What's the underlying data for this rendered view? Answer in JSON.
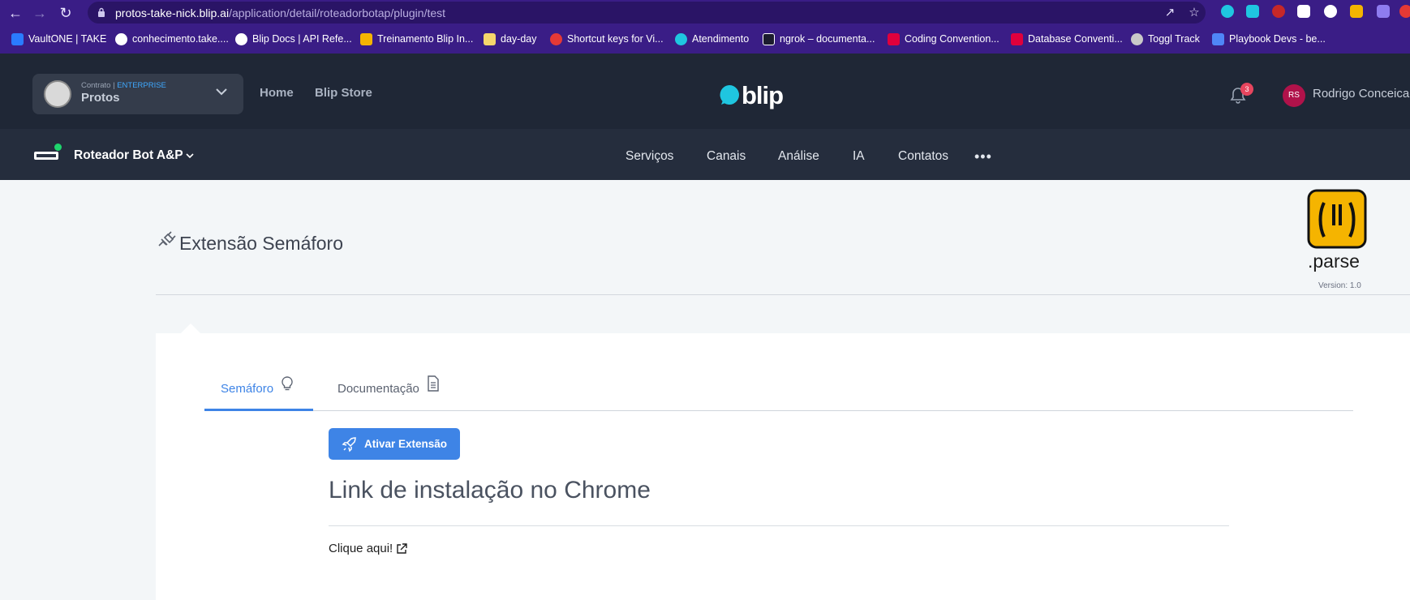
{
  "browser": {
    "url_host": "protos-take-nick.blip.ai",
    "url_path": "/application/detail/roteadorbotap/plugin/test",
    "bookmarks": [
      {
        "label": "VaultONE | TAKE",
        "color": "#2a7bff"
      },
      {
        "label": "conhecimento.take....",
        "color": "#ffffff"
      },
      {
        "label": "Blip Docs | API Refe...",
        "color": "#ffffff"
      },
      {
        "label": "Treinamento Blip In...",
        "color": "#f4b400"
      },
      {
        "label": "day-day",
        "color": "#f6d66b"
      },
      {
        "label": "Shortcut keys for Vi...",
        "color": "#e53935"
      },
      {
        "label": "Atendimento",
        "color": "#1fc6e0"
      },
      {
        "label": "ngrok – documenta...",
        "color": "#1c1c2e"
      },
      {
        "label": "Coding Convention...",
        "color": "#e0003c"
      },
      {
        "label": "Database Conventi...",
        "color": "#e0003c"
      },
      {
        "label": "Toggl Track",
        "color": "#c9c9c9"
      },
      {
        "label": "Playbook Devs - be...",
        "color": "#4f86f7"
      }
    ]
  },
  "header": {
    "contract_label": "Contrato |",
    "contract_tier": "ENTERPRISE",
    "contract_name": "Protos",
    "nav_home": "Home",
    "nav_store": "Blip Store",
    "logo_text": "blip",
    "notification_count": "3",
    "user_initials": "RS",
    "user_name": "Rodrigo Conceicao"
  },
  "subheader": {
    "bot_name": "Roteador Bot A&P",
    "bot_status_color": "#1ed46c",
    "nav": [
      "Serviços",
      "Canais",
      "Análise",
      "IA",
      "Contatos"
    ],
    "more": "•••"
  },
  "page": {
    "title": "Extensão Semáforo",
    "parse_text": ".parse",
    "version": "Version: 1.0",
    "tabs": [
      {
        "label": "Semáforo",
        "icon": "lightbulb-icon",
        "active": true
      },
      {
        "label": "Documentação",
        "icon": "document-icon",
        "active": false
      }
    ],
    "activate_button": "Ativar Extensão",
    "section_heading": "Link de instalação no Chrome",
    "link_text": "Clique aqui!"
  },
  "colors": {
    "accent": "#3e84e6",
    "header_bg": "#1f2736",
    "browser_bg": "#3a1d86"
  }
}
